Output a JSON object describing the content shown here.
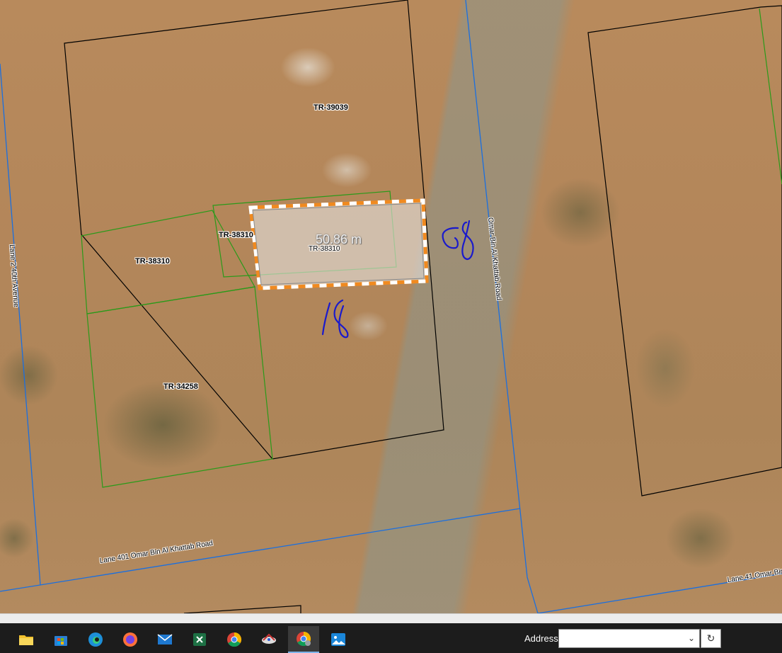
{
  "map": {
    "parcels": [
      {
        "id": "TR-39039"
      },
      {
        "id": "TR-38310"
      },
      {
        "id": "TR-38310"
      },
      {
        "id": "TR-38310"
      },
      {
        "id": "TR-34258"
      }
    ],
    "roads": [
      {
        "name": "Lane 2 40th Avenue"
      },
      {
        "name": "Omar Bin Al Khattab Road"
      },
      {
        "name": "Lane 401 Omar Bin Al Khattab Road"
      },
      {
        "name": "Lane 41 Omar Bin"
      }
    ],
    "measurement": {
      "label": "50.86 m"
    },
    "annotations": [
      {
        "text": "58",
        "color": "#1a1acc"
      },
      {
        "text": "18",
        "color": "#1a1acc"
      }
    ],
    "colors": {
      "parcel_border": "#000000",
      "lot_border": "#2a9a1a",
      "road_line": "#1a6fe0",
      "measure_dash_a": "#f08a20",
      "measure_dash_b": "#ffffff"
    }
  },
  "taskbar": {
    "apps": [
      {
        "name": "File Explorer",
        "icon": "folder-icon"
      },
      {
        "name": "Microsoft Store",
        "icon": "store-icon"
      },
      {
        "name": "Microsoft Edge",
        "icon": "edge-icon"
      },
      {
        "name": "Firefox",
        "icon": "firefox-icon"
      },
      {
        "name": "Mail",
        "icon": "mail-icon"
      },
      {
        "name": "Excel",
        "icon": "excel-icon"
      },
      {
        "name": "Google Chrome",
        "icon": "chrome-icon"
      },
      {
        "name": "Satellite App",
        "icon": "satellite-icon"
      },
      {
        "name": "Chrome Profile",
        "icon": "chrome-profile-icon"
      },
      {
        "name": "Photos",
        "icon": "photos-icon"
      }
    ],
    "address": {
      "label": "Address",
      "value": "",
      "placeholder": ""
    }
  }
}
